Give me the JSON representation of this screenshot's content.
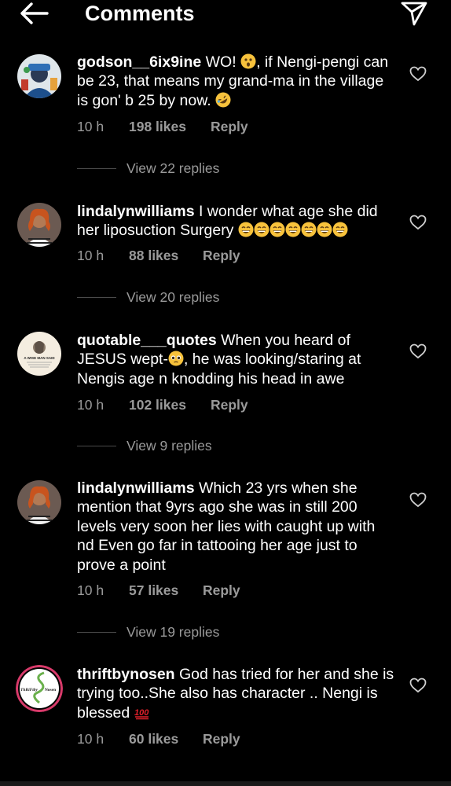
{
  "header": {
    "title": "Comments",
    "back_icon": "arrow-left-icon",
    "send_icon": "send-icon"
  },
  "colors": {
    "background": "#000000",
    "text": "#ffffff",
    "secondary": "#9a9a9a"
  },
  "comments": [
    {
      "username": "godson__6ix9ine",
      "text_parts": [
        "WO! ",
        ", if Nengi-pengi can be 23, that means my grand-ma in the village is gon' b 25 by now. ",
        ""
      ],
      "emojis": [
        "astonished-face",
        "rolling-laughing-face"
      ],
      "time": "10 h",
      "likes": "198 likes",
      "reply": "Reply",
      "view_replies": "View 22 replies"
    },
    {
      "username": "lindalynwilliams",
      "text_parts": [
        "I wonder what age she did her liposuction Surgery "
      ],
      "emojis": [
        "grinning-face",
        "grinning-face",
        "grinning-face",
        "grinning-face",
        "grinning-face",
        "grinning-face",
        "grinning-face"
      ],
      "time": "10 h",
      "likes": "88 likes",
      "reply": "Reply",
      "view_replies": "View 20 replies"
    },
    {
      "username": "quotable___quotes",
      "text_parts": [
        "When you heard of JESUS wept-",
        ", he was looking/staring at Nengis age n knodding his head in awe"
      ],
      "emojis": [
        "pleading-face"
      ],
      "time": "10 h",
      "likes": "102 likes",
      "reply": "Reply",
      "view_replies": "View 9 replies"
    },
    {
      "username": "lindalynwilliams",
      "text_parts": [
        "Which 23 yrs when she mention that 9yrs ago she was in still 200 levels very soon her lies with caught up with nd Even go far in tattooing her age just to prove a point"
      ],
      "emojis": [],
      "time": "10 h",
      "likes": "57 likes",
      "reply": "Reply",
      "view_replies": "View 19 replies"
    },
    {
      "username": "thriftbynosen",
      "text_parts": [
        "God has tried for her and she is trying too..She also has character .. Nengi is blessed "
      ],
      "emojis": [
        "hundred-points"
      ],
      "time": "10 h",
      "likes": "60 likes",
      "reply": "Reply"
    }
  ],
  "avatar_labels": {
    "quotable": "A WISE MAN SAID",
    "thrift_left": "ThRiFtby",
    "thrift_right": "Nosen"
  }
}
